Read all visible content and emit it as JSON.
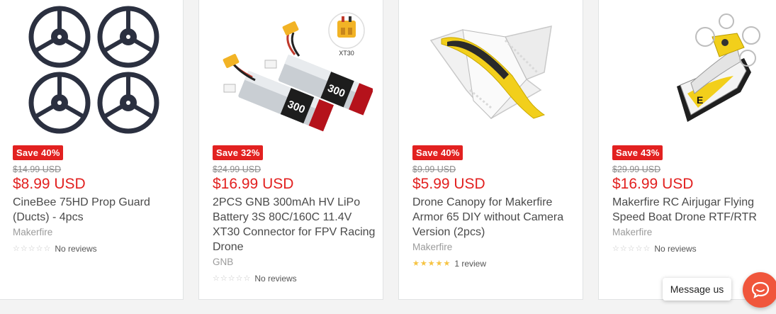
{
  "products": [
    {
      "badge": "Save 40%",
      "compare_price": "$14.99 USD",
      "price": "$8.99 USD",
      "title": "CineBee 75HD Prop Guard (Ducts) - 4pcs",
      "vendor": "Makerfire",
      "stars": "☆☆☆☆☆",
      "reviews": "No reviews",
      "image_icon": "prop-guard-image"
    },
    {
      "badge": "Save 32%",
      "compare_price": "$24.99 USD",
      "price": "$16.99 USD",
      "title": "2PCS GNB 300mAh HV LiPo Battery 3S 80C/160C 11.4V XT30 Connector for FPV Racing Drone",
      "vendor": "GNB",
      "stars": "☆☆☆☆☆",
      "reviews": "No reviews",
      "image_icon": "lipo-battery-image",
      "image_text_1": "300",
      "image_text_2": "300",
      "connector_label": "XT30"
    },
    {
      "badge": "Save 40%",
      "compare_price": "$9.99 USD",
      "price": "$5.99 USD",
      "title": "Drone Canopy for Makerfire Armor 65 DIY without Camera Version (2pcs)",
      "vendor": "Makerfire",
      "stars": "★★★★★",
      "reviews": "1 review",
      "image_icon": "drone-canopy-image"
    },
    {
      "badge": "Save 43%",
      "compare_price": "$29.99 USD",
      "price": "$16.99 USD",
      "title": "Makerfire RC Airjugar Flying Speed Boat Drone RTF/RTR",
      "vendor": "Makerfire",
      "stars": "☆☆☆☆☆",
      "reviews": "No reviews",
      "image_icon": "speed-boat-drone-image"
    }
  ],
  "chat": {
    "label": "Message us",
    "icon": "chat-bubble-icon"
  },
  "colors": {
    "sale_red": "#e22120",
    "star_gold": "#f6c342",
    "chat_orange": "#f0563c"
  }
}
